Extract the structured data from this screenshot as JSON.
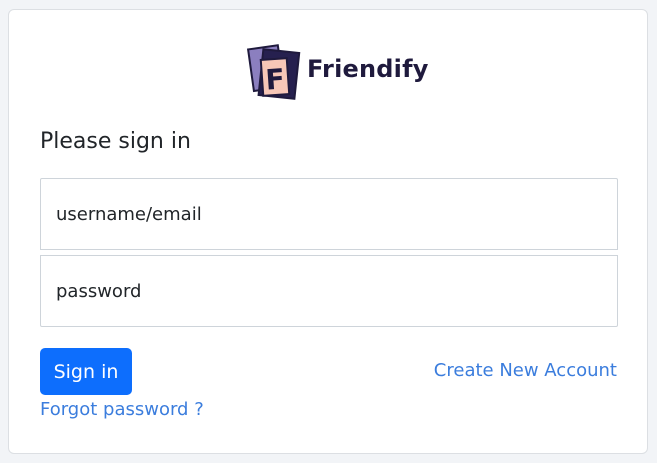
{
  "brand": {
    "name": "Friendify",
    "logo_letter": "F",
    "colors": {
      "back_card": "#8b7fbf",
      "front_card": "#f7c7b7",
      "ink": "#1f1a3d"
    }
  },
  "form": {
    "heading": "Please sign in",
    "username_placeholder": "username/email",
    "password_placeholder": "password",
    "submit_label": "Sign in"
  },
  "links": {
    "create_account": "Create New Account",
    "forgot_password": "Forgot password ?"
  },
  "colors": {
    "primary": "#0d6efd",
    "link": "#3b7ddd",
    "text": "#212529",
    "border": "#ced4da"
  }
}
